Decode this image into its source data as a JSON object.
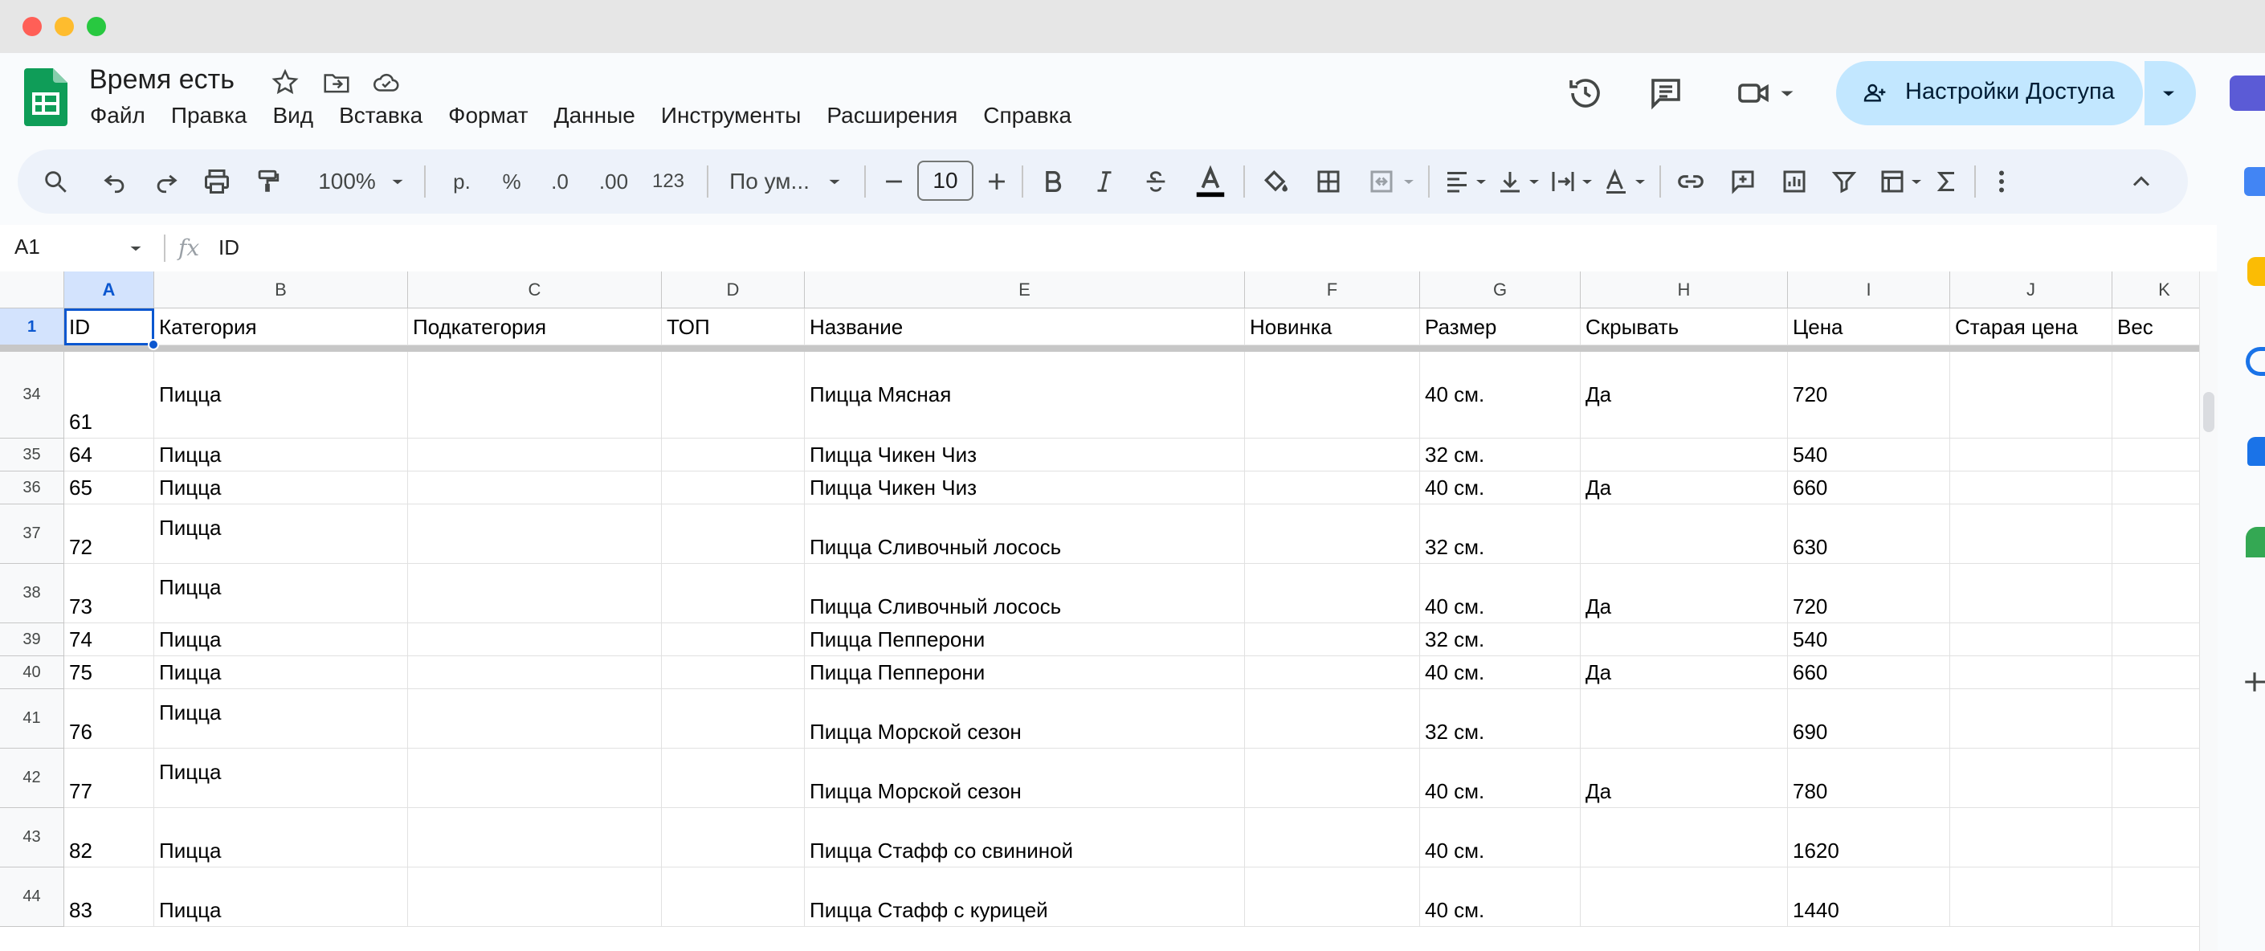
{
  "window": {
    "traffic_colors": [
      "#ff5f57",
      "#febc2e",
      "#28c840"
    ]
  },
  "doc": {
    "title": "Время есть"
  },
  "menu": [
    "Файл",
    "Правка",
    "Вид",
    "Вставка",
    "Формат",
    "Данные",
    "Инструменты",
    "Расширения",
    "Справка"
  ],
  "share": {
    "label": "Настройки Доступа"
  },
  "toolbar": {
    "zoom": "100%",
    "currency": "р.",
    "percent": "%",
    "dec_less": ".0",
    "dec_more": ".00",
    "number_format": "123",
    "font": "По ум...",
    "font_size": "10"
  },
  "formula_bar": {
    "cell_ref": "A1",
    "fx": "fx",
    "value": "ID"
  },
  "columns": [
    {
      "letter": "A"
    },
    {
      "letter": "B"
    },
    {
      "letter": "C"
    },
    {
      "letter": "D"
    },
    {
      "letter": "E"
    },
    {
      "letter": "F"
    },
    {
      "letter": "G"
    },
    {
      "letter": "H"
    },
    {
      "letter": "I"
    },
    {
      "letter": "J"
    },
    {
      "letter": "K"
    }
  ],
  "header_row": {
    "num": "1",
    "cells": [
      "ID",
      "Категория",
      "Подкатегория",
      "ТОП",
      "Название",
      "Новинка",
      "Размер",
      "Скрывать",
      "Цена",
      "Старая цена",
      "Вес"
    ]
  },
  "rows": [
    {
      "num": "34",
      "id": "61",
      "category": "Пицца",
      "name": "Пицца Мясная",
      "size": "40 см.",
      "hide": "Да",
      "price": "720"
    },
    {
      "num": "35",
      "id": "64",
      "category": "Пицца",
      "name": "Пицца Чикен Чиз",
      "size": "32 см.",
      "hide": "",
      "price": "540"
    },
    {
      "num": "36",
      "id": "65",
      "category": "Пицца",
      "name": "Пицца Чикен Чиз",
      "size": "40 см.",
      "hide": "Да",
      "price": "660"
    },
    {
      "num": "37",
      "id": "72",
      "category": "Пицца",
      "name": "Пицца Сливочный лосось",
      "size": "32 см.",
      "hide": "",
      "price": "630"
    },
    {
      "num": "38",
      "id": "73",
      "category": "Пицца",
      "name": "Пицца Сливочный лосось",
      "size": "40 см.",
      "hide": "Да",
      "price": "720"
    },
    {
      "num": "39",
      "id": "74",
      "category": "Пицца",
      "name": "Пицца Пепперони",
      "size": "32 см.",
      "hide": "",
      "price": "540"
    },
    {
      "num": "40",
      "id": "75",
      "category": "Пицца",
      "name": "Пицца Пепперони",
      "size": "40 см.",
      "hide": "Да",
      "price": "660"
    },
    {
      "num": "41",
      "id": "76",
      "category": "Пицца",
      "name": "Пицца Морской сезон",
      "size": "32 см.",
      "hide": "",
      "price": "690"
    },
    {
      "num": "42",
      "id": "77",
      "category": "Пицца",
      "name": "Пицца Морской сезон",
      "size": "40 см.",
      "hide": "Да",
      "price": "780"
    },
    {
      "num": "43",
      "id": "82",
      "category": "Пицца",
      "name": "Пицца Стафф со свининой",
      "size": "40 см.",
      "hide": "",
      "price": "1620"
    },
    {
      "num": "44",
      "id": "83",
      "category": "Пицца",
      "name": "Пицца Стафф с курицей",
      "size": "40 см.",
      "hide": "",
      "price": "1440"
    }
  ]
}
